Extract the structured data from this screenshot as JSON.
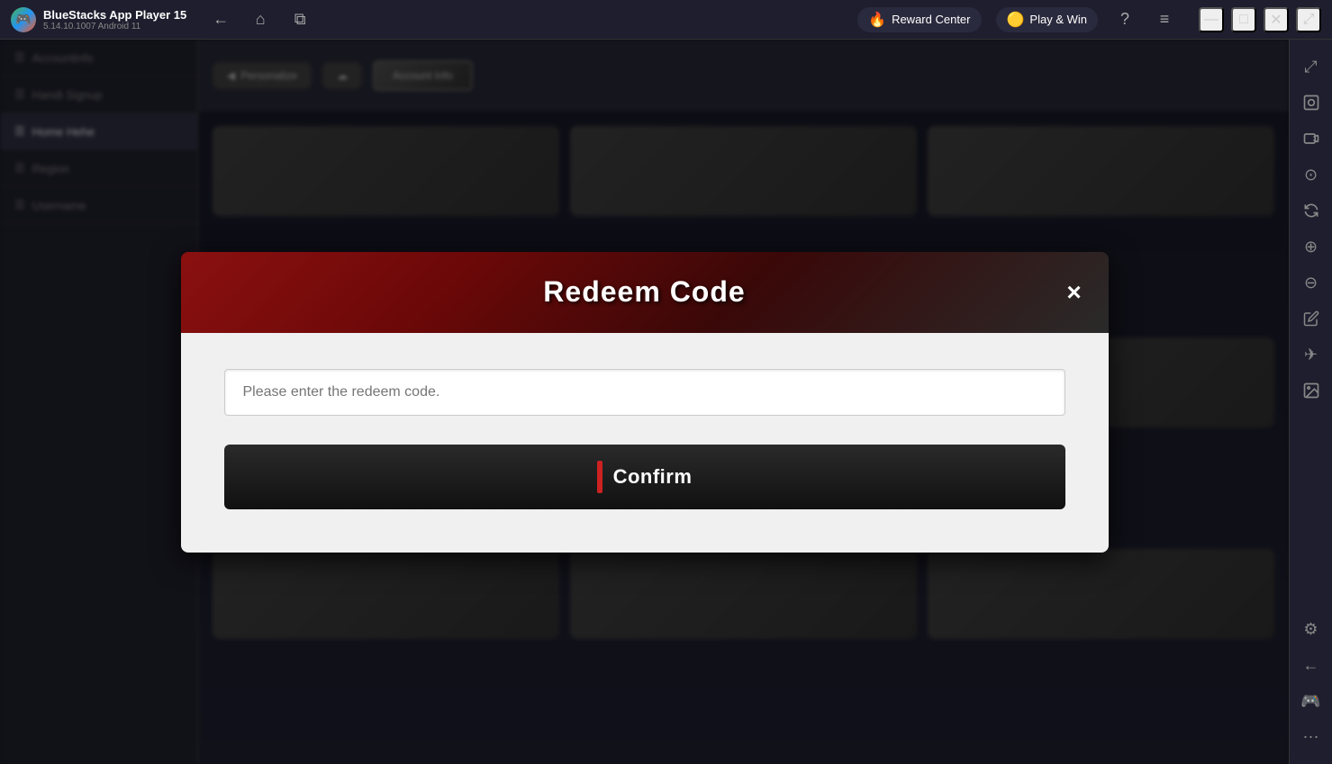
{
  "app": {
    "name": "BlueStacks App Player 15",
    "version": "5.14.10.1007  Android 11"
  },
  "titlebar": {
    "back_label": "←",
    "home_label": "⌂",
    "multi_label": "⧉",
    "reward_center": "Reward Center",
    "play_and_win": "Play & Win",
    "help_icon": "?",
    "menu_icon": "≡",
    "minimize_label": "—",
    "maximize_label": "□",
    "close_label": "✕",
    "expand_label": "⤢"
  },
  "sidebar_right": {
    "icons": [
      {
        "name": "expand-icon",
        "symbol": "⤢"
      },
      {
        "name": "screenshot-icon",
        "symbol": "📷"
      },
      {
        "name": "camera-icon",
        "symbol": "🎥"
      },
      {
        "name": "record-icon",
        "symbol": "⊙"
      },
      {
        "name": "rotate-icon",
        "symbol": "↻"
      },
      {
        "name": "zoom-in-icon",
        "symbol": "⊕"
      },
      {
        "name": "zoom-out-icon",
        "symbol": "⊖"
      },
      {
        "name": "edit-icon",
        "symbol": "✏"
      },
      {
        "name": "move-icon",
        "symbol": "✈"
      },
      {
        "name": "screenshot2-icon",
        "symbol": "🖼"
      },
      {
        "name": "settings-icon",
        "symbol": "⚙"
      },
      {
        "name": "arrow-left-icon",
        "symbol": "←"
      },
      {
        "name": "gamepad-icon",
        "symbol": "🎮"
      },
      {
        "name": "more-icon",
        "symbol": "⋯"
      }
    ]
  },
  "modal": {
    "title": "Redeem Code",
    "close_label": "×",
    "input_placeholder": "Please enter the redeem code.",
    "confirm_label": "Confirm"
  },
  "left_panel": {
    "items": [
      {
        "label": "Accountinfo",
        "active": false
      },
      {
        "label": "Handi Signup",
        "active": false
      },
      {
        "label": "Home Hehe",
        "active": true
      },
      {
        "label": "Region",
        "active": false
      },
      {
        "label": "Username",
        "active": false
      }
    ]
  },
  "toolbar": {
    "personalize_label": "Personalize",
    "account_info_label": "Account Info"
  }
}
